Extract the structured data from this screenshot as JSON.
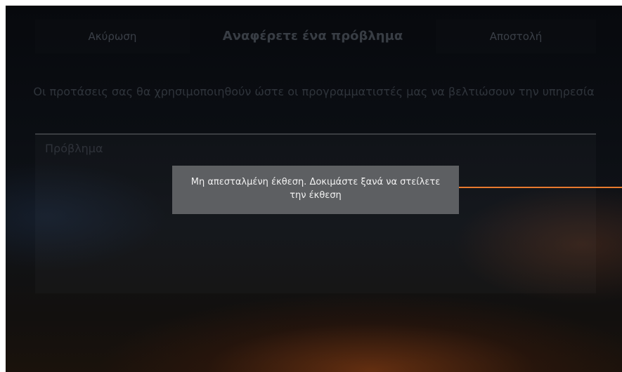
{
  "header": {
    "cancel_label": "Ακύρωση",
    "title": "Αναφέρετε ένα πρόβλημα",
    "send_label": "Αποστολή"
  },
  "description": "Οι προτάσεις σας θα χρησιμοποιηθούν ώστε οι προγραμματιστές μας να βελτιώσουν την υπηρεσία",
  "problem_field": {
    "placeholder": "Πρόβλημα"
  },
  "toast": {
    "message": "Μη απεσταλμένη έκθεση. Δοκιμάστε ξανά να στείλετε την έκθεση"
  },
  "colors": {
    "accent": "#e87a2e",
    "toast_bg": "#5d5f62"
  }
}
